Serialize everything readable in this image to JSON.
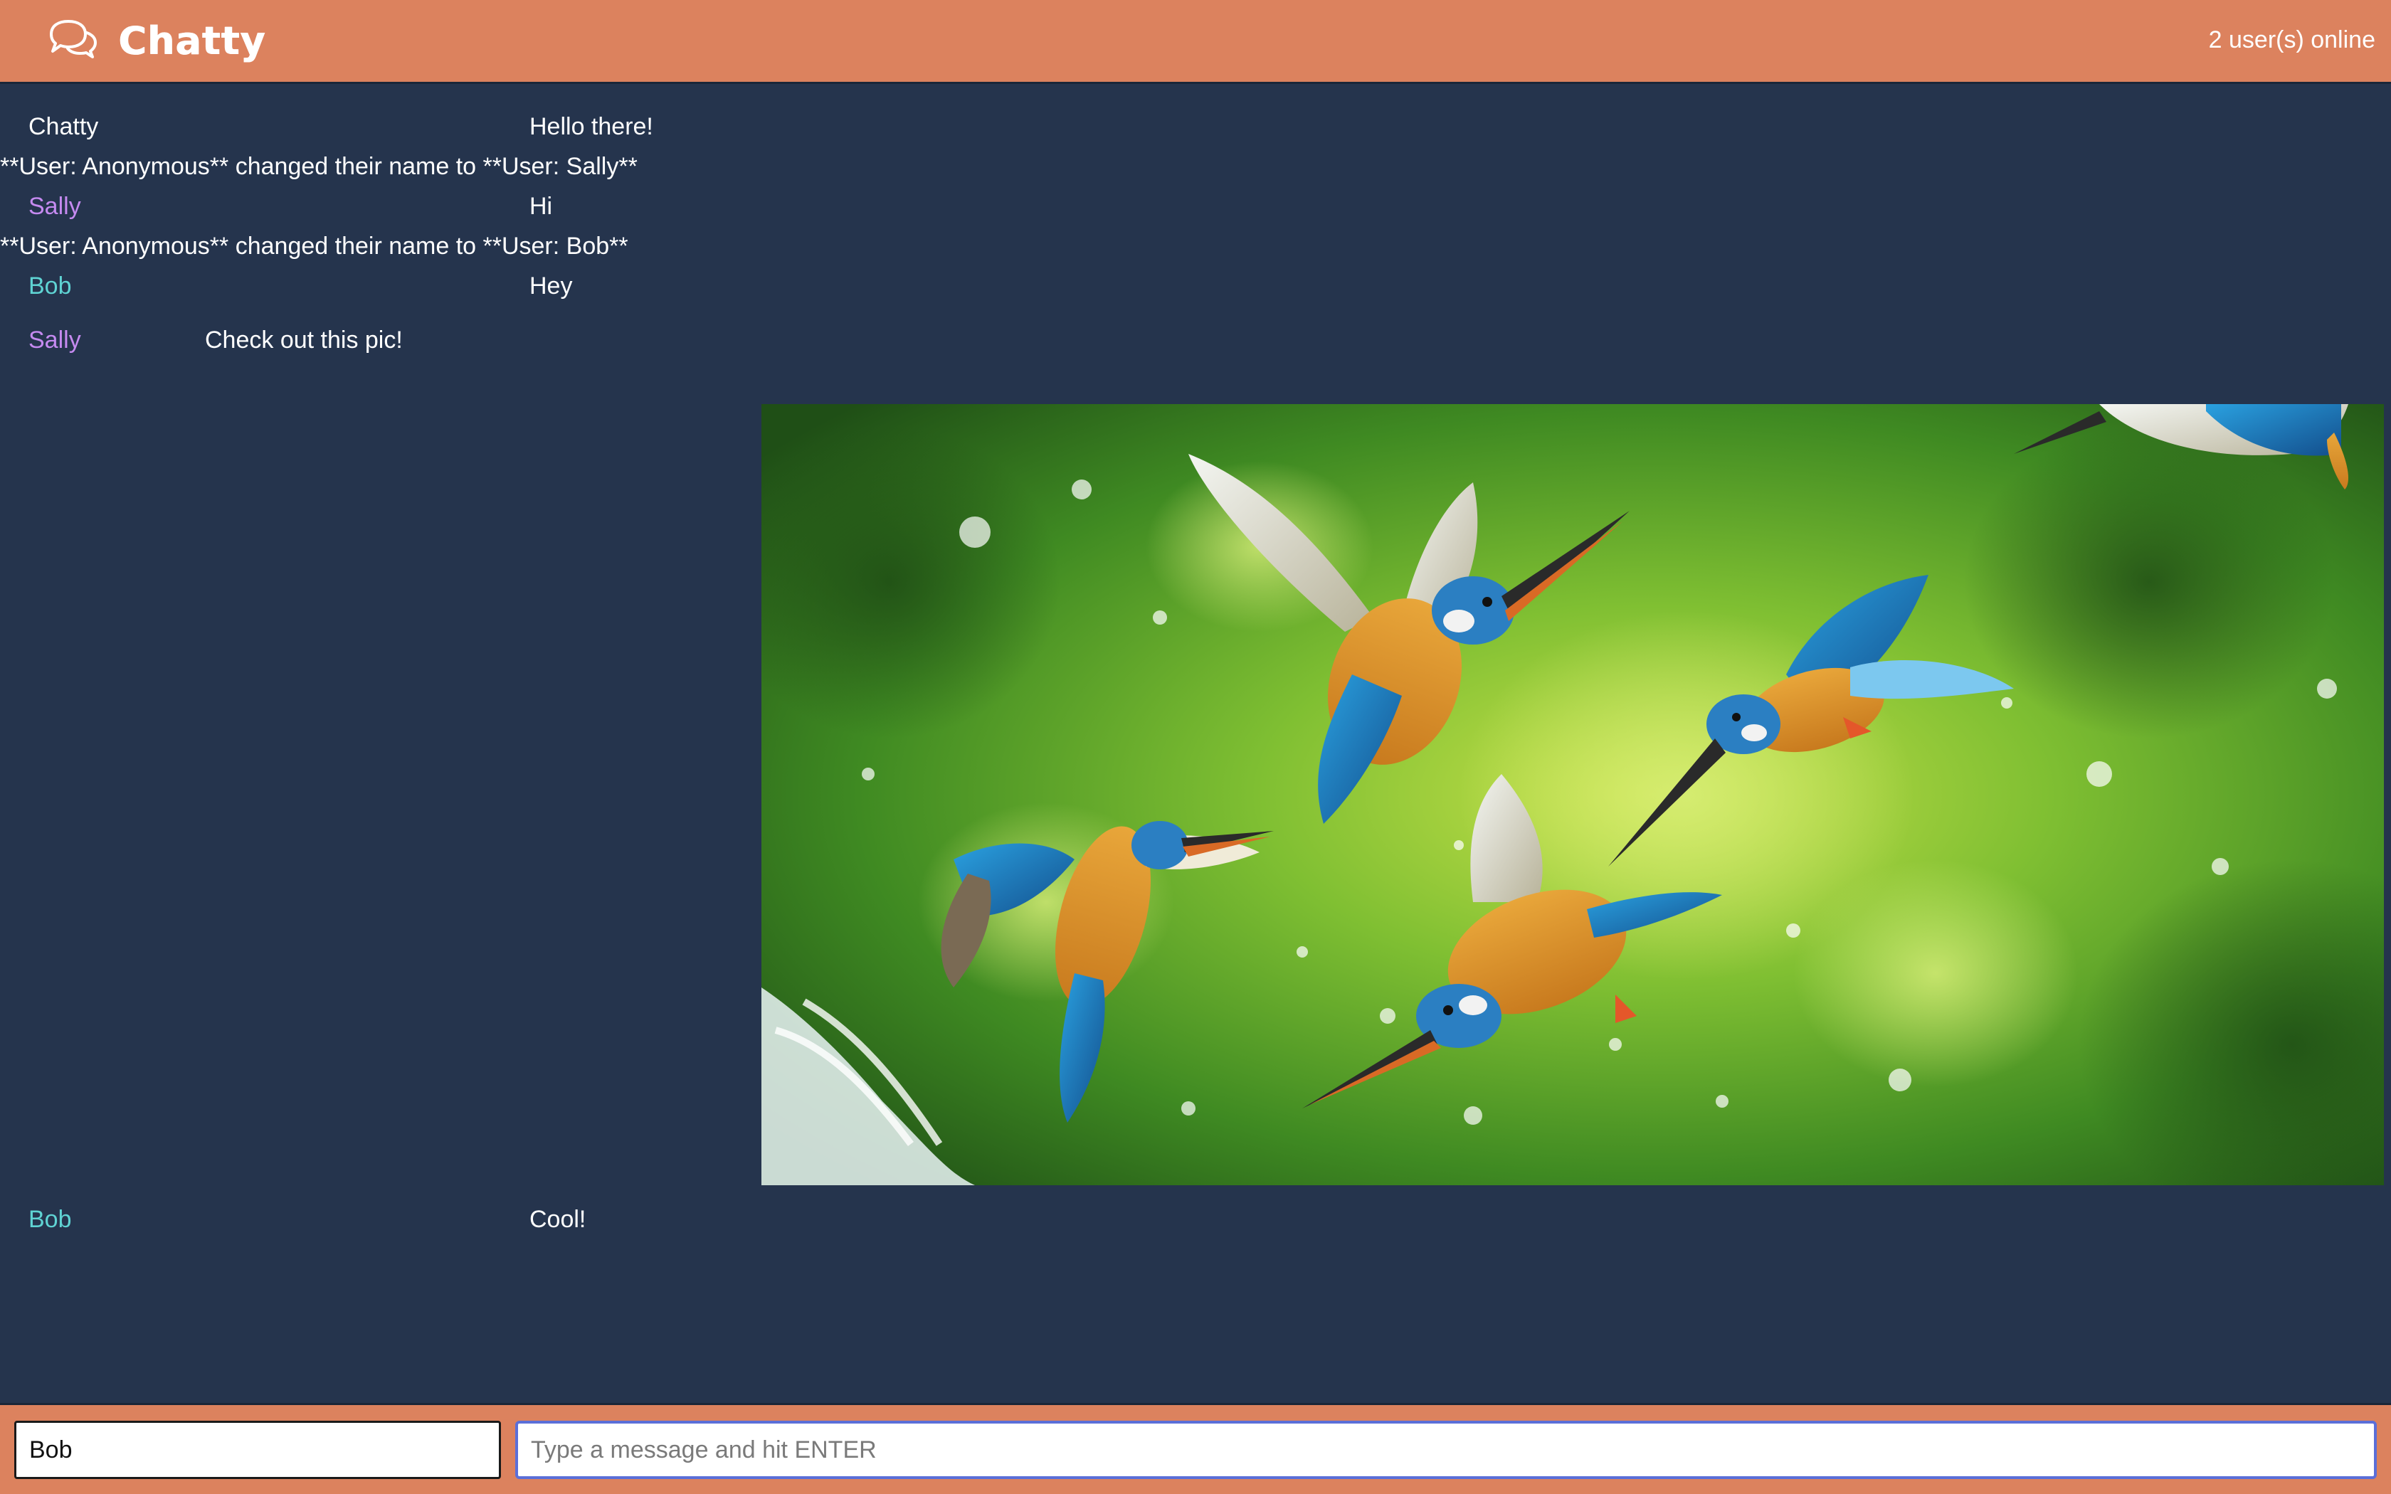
{
  "header": {
    "app_name": "Chatty",
    "logo_icon": "chat-bubbles-icon",
    "online_status": "2 user(s) online"
  },
  "colors": {
    "accent": "#dc825e",
    "background": "#25344d",
    "sally": "#c58af0",
    "bob": "#5fd3d3",
    "system_user": "#ffffff"
  },
  "messages": [
    {
      "type": "chat",
      "user": "Chatty",
      "text": "Hello there!",
      "user_color": "#ffffff"
    },
    {
      "type": "system",
      "text": "**User: Anonymous** changed their name to **User: Sally**"
    },
    {
      "type": "chat",
      "user": "Sally",
      "text": "Hi",
      "user_color": "#c58af0"
    },
    {
      "type": "system",
      "text": "**User: Anonymous** changed their name to **User: Bob**"
    },
    {
      "type": "chat",
      "user": "Bob",
      "text": "Hey",
      "user_color": "#5fd3d3"
    },
    {
      "type": "image",
      "user": "Sally",
      "text": "Check out this pic!",
      "user_color": "#c58af0",
      "image": "kingfishers-photo"
    },
    {
      "type": "chat",
      "user": "Bob",
      "text": "Cool!",
      "user_color": "#5fd3d3"
    }
  ],
  "composer": {
    "name_value": "Bob",
    "message_value": "",
    "message_placeholder": "Type a message and hit ENTER"
  }
}
